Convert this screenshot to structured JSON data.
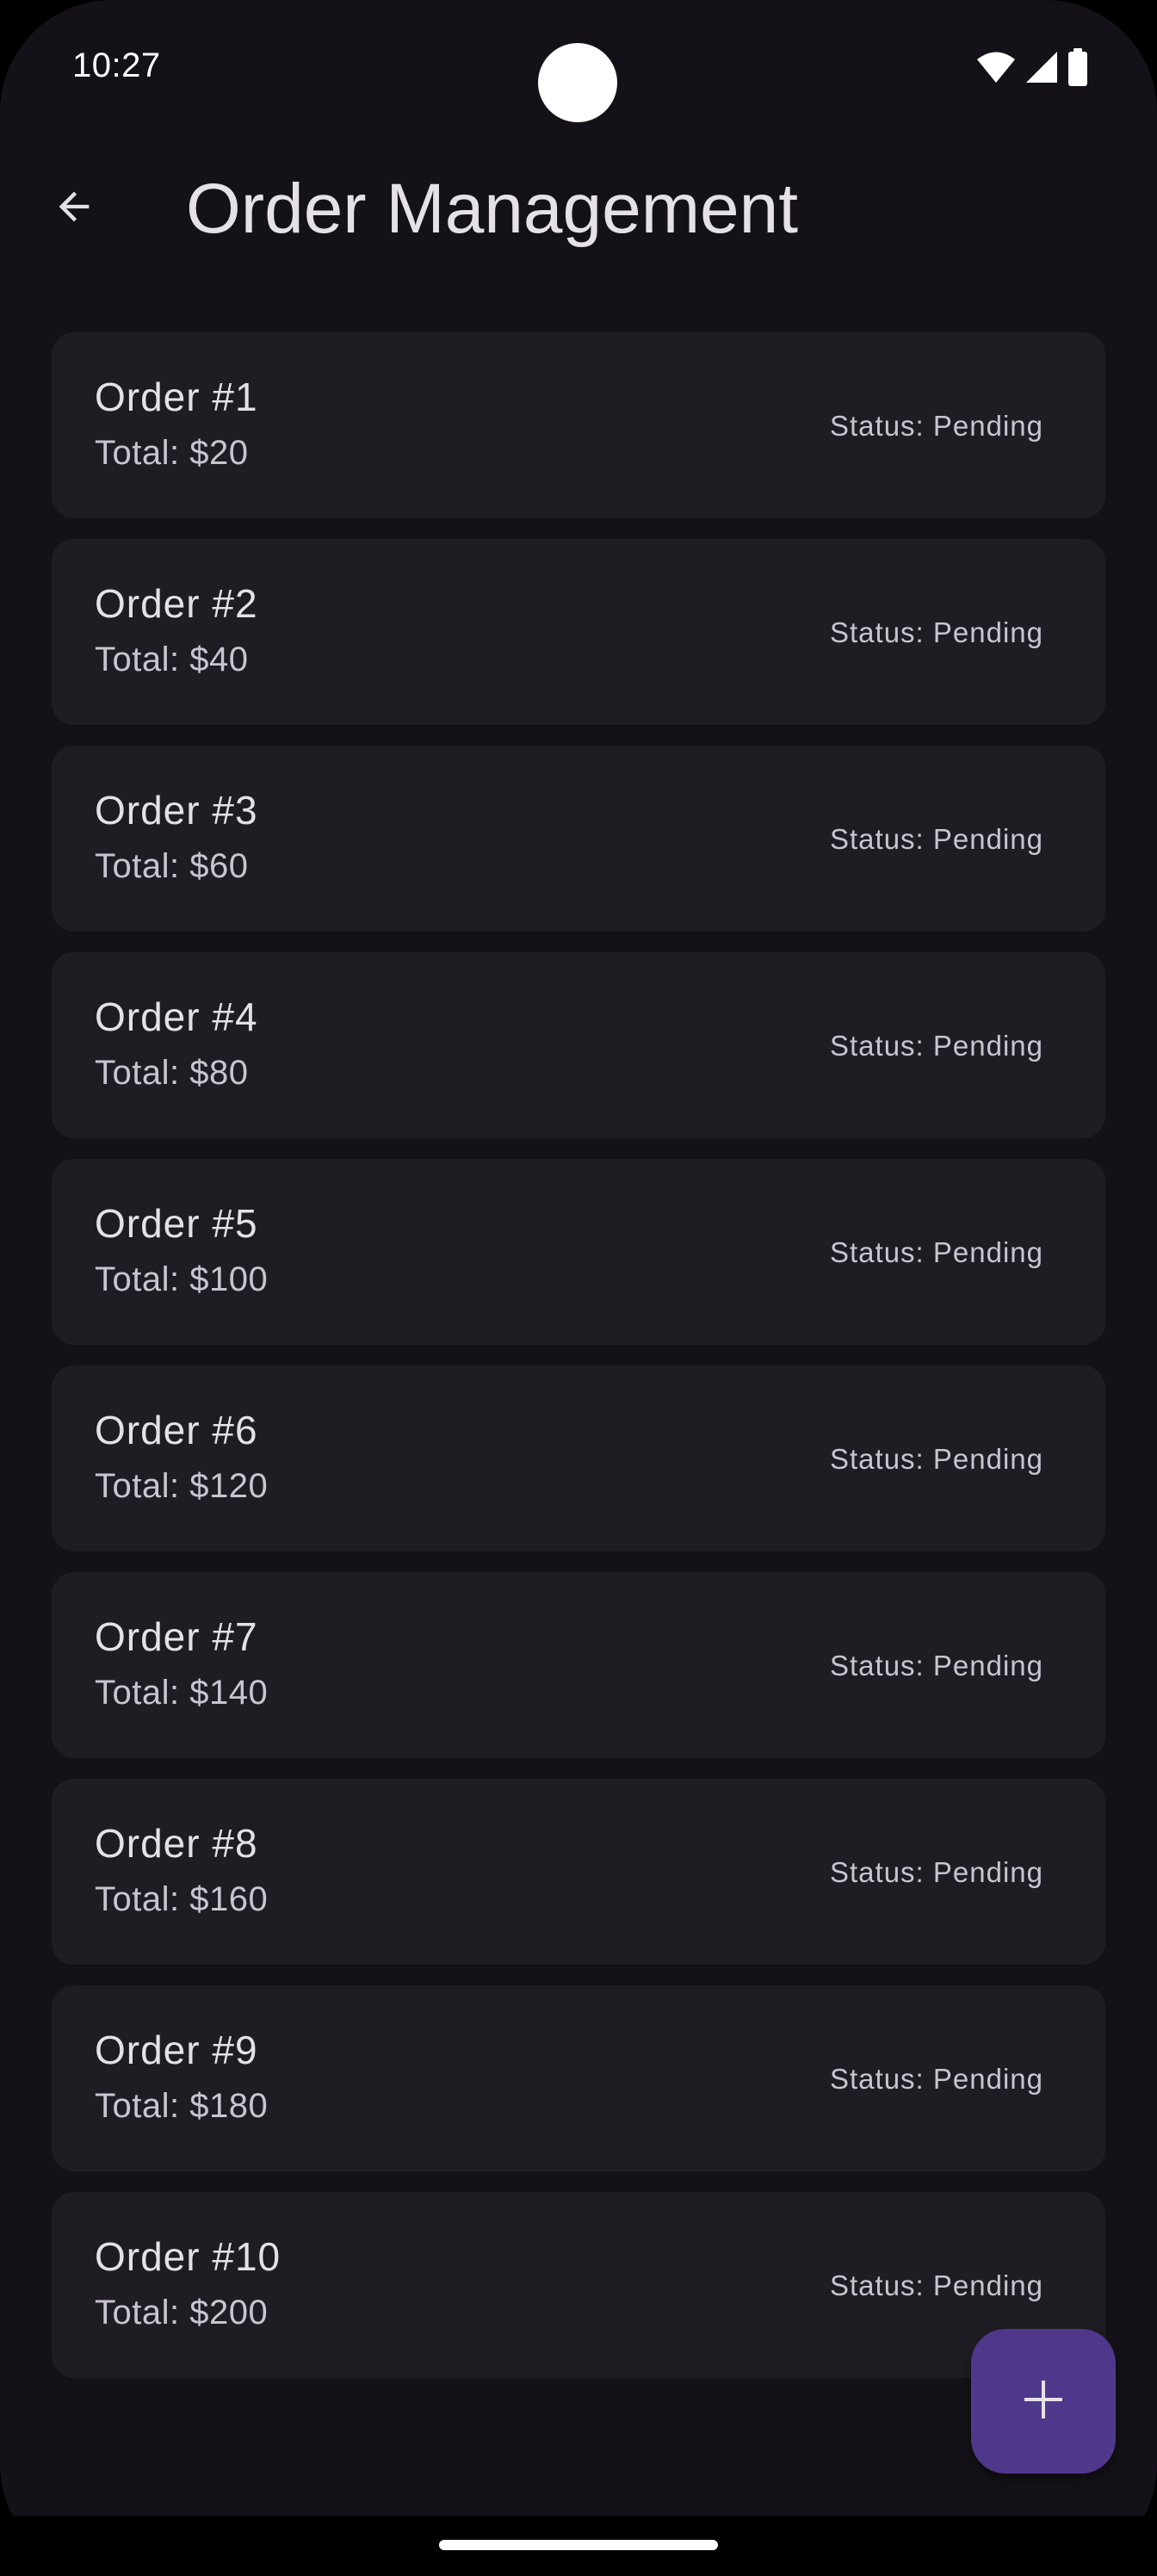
{
  "status_bar": {
    "time": "10:27",
    "icons": [
      "wifi-icon",
      "cellular-signal-icon",
      "battery-icon"
    ]
  },
  "app_bar": {
    "back_icon": "arrow-back-icon",
    "title": "Order Management"
  },
  "orders": [
    {
      "title": "Order #1",
      "total": "Total: $20",
      "status": "Status: Pending"
    },
    {
      "title": "Order #2",
      "total": "Total: $40",
      "status": "Status: Pending"
    },
    {
      "title": "Order #3",
      "total": "Total: $60",
      "status": "Status: Pending"
    },
    {
      "title": "Order #4",
      "total": "Total: $80",
      "status": "Status: Pending"
    },
    {
      "title": "Order #5",
      "total": "Total: $100",
      "status": "Status: Pending"
    },
    {
      "title": "Order #6",
      "total": "Total: $120",
      "status": "Status: Pending"
    },
    {
      "title": "Order #7",
      "total": "Total: $140",
      "status": "Status: Pending"
    },
    {
      "title": "Order #8",
      "total": "Total: $160",
      "status": "Status: Pending"
    },
    {
      "title": "Order #9",
      "total": "Total: $180",
      "status": "Status: Pending"
    },
    {
      "title": "Order #10",
      "total": "Total: $200",
      "status": "Status: Pending"
    }
  ],
  "fab": {
    "icon": "add-icon"
  },
  "colors": {
    "background": "#141218",
    "card": "#1f1d23",
    "primary_text": "#e6e0e9",
    "secondary_text": "#cac4d0",
    "fab": "#4f378b",
    "fab_icon": "#e6e0e9"
  }
}
